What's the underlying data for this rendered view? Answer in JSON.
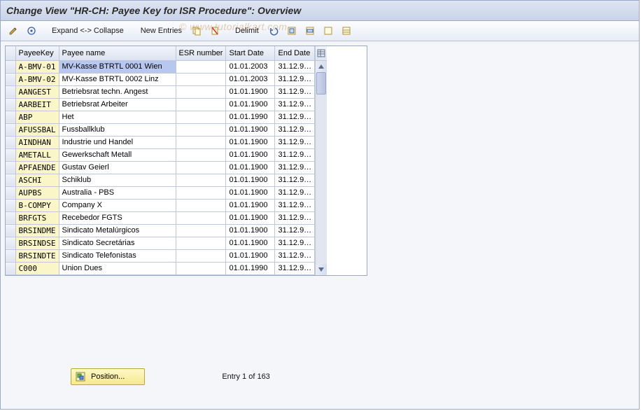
{
  "title": "Change View \"HR-CH: Payee Key for ISR Procedure\": Overview",
  "toolbar": {
    "expand_collapse": "Expand <-> Collapse",
    "new_entries": "New Entries",
    "delimit": "Delimit"
  },
  "columns": {
    "payee_key": "PayeeKey",
    "payee_name": "Payee name",
    "esr_number": "ESR number",
    "start_date": "Start Date",
    "end_date": "End Date"
  },
  "rows": [
    {
      "key": "A-BMV-01",
      "name": "MV-Kasse  BTRTL 0001 Wien",
      "esr": "",
      "start": "01.01.2003",
      "end": "31.12.9…"
    },
    {
      "key": "A-BMV-02",
      "name": "MV-Kasse  BTRTL 0002 Linz",
      "esr": "",
      "start": "01.01.2003",
      "end": "31.12.9…"
    },
    {
      "key": "AANGEST",
      "name": "Betriebsrat techn. Angest",
      "esr": "",
      "start": "01.01.1900",
      "end": "31.12.9…"
    },
    {
      "key": "AARBEIT",
      "name": "Betriebsrat Arbeiter",
      "esr": "",
      "start": "01.01.1900",
      "end": "31.12.9…"
    },
    {
      "key": "ABP",
      "name": "Het",
      "esr": "",
      "start": "01.01.1990",
      "end": "31.12.9…"
    },
    {
      "key": "AFUSSBAL",
      "name": "Fussballklub",
      "esr": "",
      "start": "01.01.1900",
      "end": "31.12.9…"
    },
    {
      "key": "AINDHAN",
      "name": "Industrie und Handel",
      "esr": "",
      "start": "01.01.1900",
      "end": "31.12.9…"
    },
    {
      "key": "AMETALL",
      "name": "Gewerkschaft Metall",
      "esr": "",
      "start": "01.01.1900",
      "end": "31.12.9…"
    },
    {
      "key": "APFAENDE",
      "name": "Gustav Geierl",
      "esr": "",
      "start": "01.01.1900",
      "end": "31.12.9…"
    },
    {
      "key": "ASCHI",
      "name": "Schiklub",
      "esr": "",
      "start": "01.01.1900",
      "end": "31.12.9…"
    },
    {
      "key": "AUPBS",
      "name": "Australia - PBS",
      "esr": "",
      "start": "01.01.1900",
      "end": "31.12.9…"
    },
    {
      "key": "B-COMPY",
      "name": "Company X",
      "esr": "",
      "start": "01.01.1900",
      "end": "31.12.9…"
    },
    {
      "key": "BRFGTS",
      "name": "Recebedor FGTS",
      "esr": "",
      "start": "01.01.1900",
      "end": "31.12.9…"
    },
    {
      "key": "BRSINDME",
      "name": "Sindicato Metalúrgicos",
      "esr": "",
      "start": "01.01.1900",
      "end": "31.12.9…"
    },
    {
      "key": "BRSINDSE",
      "name": "Sindicato Secretárias",
      "esr": "",
      "start": "01.01.1900",
      "end": "31.12.9…"
    },
    {
      "key": "BRSINDTE",
      "name": "Sindicato Telefonistas",
      "esr": "",
      "start": "01.01.1900",
      "end": "31.12.9…"
    },
    {
      "key": "C000",
      "name": "Union Dues",
      "esr": "",
      "start": "01.01.1990",
      "end": "31.12.9…"
    }
  ],
  "footer": {
    "position_label": "Position...",
    "entry_counter": "Entry 1 of 163"
  },
  "watermark": "© www.tutorialkart.com"
}
